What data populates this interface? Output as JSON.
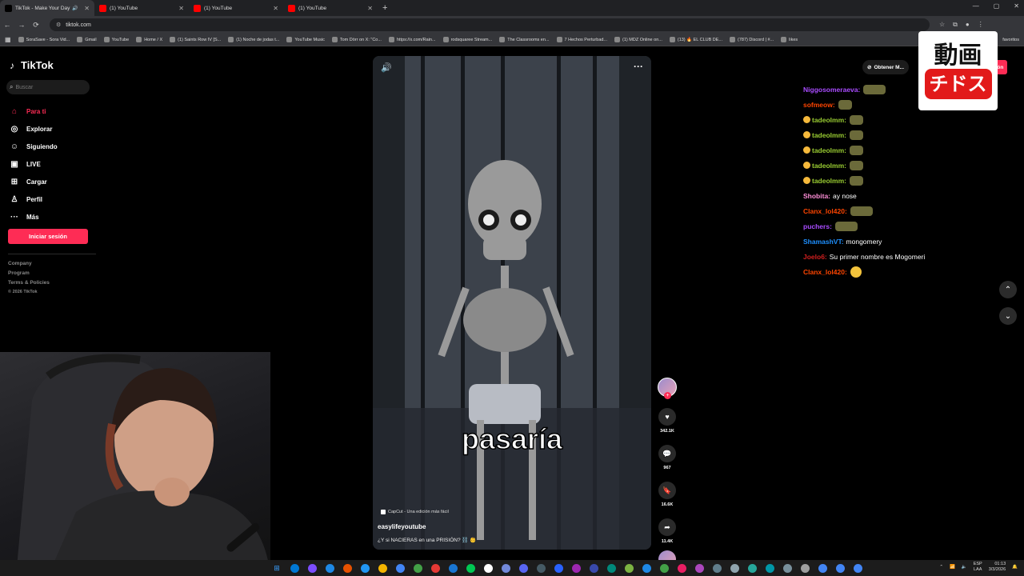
{
  "browser": {
    "tabs": [
      {
        "title": "TikTok - Make Your Day",
        "active": true,
        "icon_color": "#000000"
      },
      {
        "title": "(1) YouTube",
        "active": false,
        "icon_color": "#ff0000"
      },
      {
        "title": "(1) YouTube",
        "active": false,
        "icon_color": "#ff0000"
      },
      {
        "title": "(1) YouTube",
        "active": false,
        "icon_color": "#ff0000"
      }
    ],
    "url": "tiktok.com",
    "bookmarks": [
      "SoraSave - Sora Vid...",
      "Gmail",
      "YouTube",
      "Home / X",
      "(1) Saints Row IV [S...",
      "(1) Noche de jodas t...",
      "YouTube Music",
      "Tom Dörr on X: \"Co...",
      "https://x.com/Rain...",
      "rodsquaree Stream...",
      "The Classrooms en...",
      "7 Hechos Perturbad...",
      "(1) MDZ Online on...",
      "(13) 🔥 EL CLUB DE...",
      "(787) Discord | #...",
      "likes"
    ],
    "bookmarks_more": "favoritos"
  },
  "sidebar": {
    "brand": "TikTok",
    "search_placeholder": "Buscar",
    "nav": [
      {
        "label": "Para ti",
        "icon": "home-icon",
        "active": true
      },
      {
        "label": "Explorar",
        "icon": "compass-icon",
        "active": false
      },
      {
        "label": "Siguiendo",
        "icon": "following-icon",
        "active": false
      },
      {
        "label": "LIVE",
        "icon": "live-icon",
        "active": false
      },
      {
        "label": "Cargar",
        "icon": "upload-icon",
        "active": false
      },
      {
        "label": "Perfil",
        "icon": "profile-icon",
        "active": false
      },
      {
        "label": "Más",
        "icon": "more-icon",
        "active": false
      }
    ],
    "login_button": "Iniciar sesión",
    "footer": [
      "Company",
      "Program",
      "Terms & Policies"
    ],
    "copyright": "© 2026 TikTok"
  },
  "video": {
    "caption": "pasaría",
    "capcut": "CapCut - Una edición más fácil",
    "author": "easylifeyoutube",
    "description": "¿Y si NACIERAS en una PRISIÓN? ⛓️ 👶",
    "likes": "342.1K",
    "comments": "967",
    "saves": "16.6K",
    "shares": "11.4K"
  },
  "header_right": {
    "app_button": "Obtener M...",
    "login_partial": "sión"
  },
  "chat": [
    {
      "user": "Niggosomeraeva:",
      "color": "#a94cff",
      "text": "",
      "emote": "wide",
      "badge": false
    },
    {
      "user": "sofmeow:",
      "color": "#ff4500",
      "text": "",
      "emote": "normal",
      "badge": false
    },
    {
      "user": "tadeolmm:",
      "color": "#9acd32",
      "text": "",
      "emote": "normal",
      "badge": true
    },
    {
      "user": "tadeolmm:",
      "color": "#9acd32",
      "text": "",
      "emote": "normal",
      "badge": true
    },
    {
      "user": "tadeolmm:",
      "color": "#9acd32",
      "text": "",
      "emote": "normal",
      "badge": true
    },
    {
      "user": "tadeolmm:",
      "color": "#9acd32",
      "text": "",
      "emote": "normal",
      "badge": true
    },
    {
      "user": "tadeolmm:",
      "color": "#9acd32",
      "text": "",
      "emote": "normal",
      "badge": true
    },
    {
      "user": "Shobita:",
      "color": "#ff8fd8",
      "text": "ay nose",
      "emote": "",
      "badge": false
    },
    {
      "user": "Clanx_lol420:",
      "color": "#ff4500",
      "text": "",
      "emote": "wide",
      "badge": false
    },
    {
      "user": "puchers:",
      "color": "#a94cff",
      "text": "",
      "emote": "wide",
      "badge": false
    },
    {
      "user": "ShamashVT:",
      "color": "#1e90ff",
      "text": "mongomery",
      "emote": "",
      "badge": false
    },
    {
      "user": "Joelo6:",
      "color": "#d21f1f",
      "text": "Su primer nombre es Mogomeri",
      "emote": "",
      "badge": false
    },
    {
      "user": "Clanx_lol420:",
      "color": "#ff4500",
      "text": "",
      "emote": "smile",
      "badge": false
    }
  ],
  "watermark": {
    "top": "動画",
    "bottom": "チドス"
  },
  "taskbar": {
    "lang_top": "ESP",
    "lang_bottom": "LAA",
    "time": "01:13",
    "date": "3/3/2026",
    "apps": [
      "#0078d4",
      "#7c4dff",
      "#1e88e5",
      "#e65100",
      "#2196f3",
      "#f4b400",
      "#4285f4",
      "#43a047",
      "#e53935",
      "#1976d2",
      "#00c853",
      "#ffffff",
      "#7289da",
      "#5865f2",
      "#455a64",
      "#2962ff",
      "#9c27b0",
      "#3949ab",
      "#00897b",
      "#7cb342",
      "#1e88e5",
      "#43a047",
      "#e91e63",
      "#ab47bc",
      "#607d8b",
      "#90a4ae",
      "#26a69a",
      "#0097a7",
      "#78909c",
      "#9e9e9e",
      "#4285f4",
      "#4285f4",
      "#4285f4"
    ]
  }
}
